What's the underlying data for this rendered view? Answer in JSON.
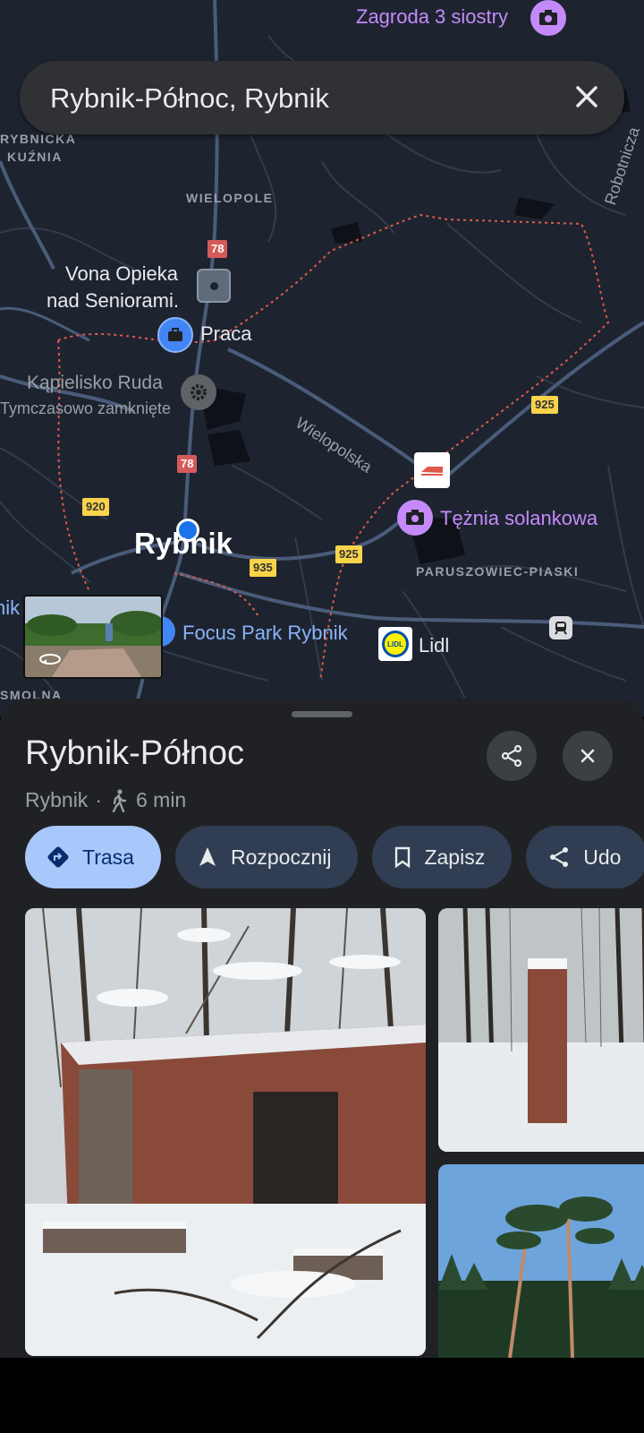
{
  "search": {
    "query": "Rybnik-Północ, Rybnik"
  },
  "map": {
    "areas": [
      "RYBNICKA",
      "KUŹNIA",
      "WIELOPOLE",
      "PARUSZOWIEC-PIASKI",
      "SMOLNA"
    ],
    "streets": {
      "wielopolska": "Wielopolska",
      "robotnicza": "Robotnicza"
    },
    "city": "Rybnik",
    "pois": {
      "zagroda": "Zagroda 3 siostry",
      "vona_line1": "Vona Opieka",
      "vona_line2": "nad Seniorami.",
      "praca": "Praca",
      "kapielisko": "Kąpielisko Ruda",
      "kapielisko_status": "Tymczasowo zamknięte",
      "teznia": "Tężnia solankowa",
      "focus": "Focus Park Rybnik",
      "lidl": "Lidl",
      "edge_label": "nik"
    },
    "shields": {
      "r78a": "78",
      "r78b": "78",
      "r920": "920",
      "r925a": "925",
      "r925b": "925",
      "r935": "935"
    }
  },
  "sheet": {
    "title": "Rybnik-Północ",
    "locality": "Rybnik",
    "separator": "·",
    "walk_time": "6 min",
    "actions": [
      "Trasa",
      "Rozpocznij",
      "Zapisz",
      "Udo"
    ]
  },
  "colors": {
    "map_bg": "#1d2430",
    "accent": "#a8c7fa",
    "poi_purple": "#c58af9",
    "poi_blue": "#8ab4f8",
    "boundary": "#e0594b"
  },
  "icons": [
    "close-icon",
    "share-icon",
    "directions-icon",
    "navigate-icon",
    "bookmark-icon",
    "walk-icon",
    "camera-icon",
    "briefcase-icon",
    "gear-icon",
    "train-icon",
    "rotate-360-icon"
  ]
}
